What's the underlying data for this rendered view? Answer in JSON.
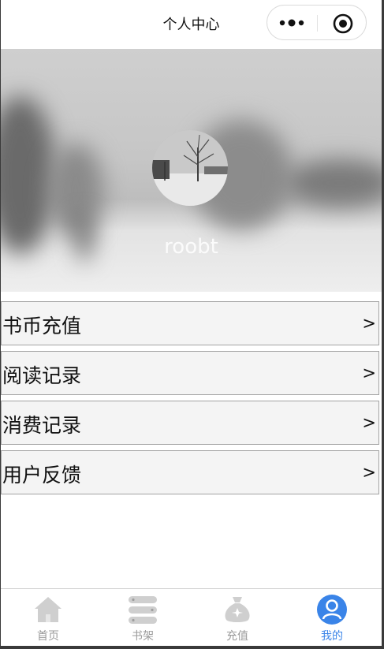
{
  "navbar": {
    "title": "个人中心"
  },
  "profile": {
    "username": "roobt"
  },
  "menu": {
    "items": [
      {
        "label": "书币充值",
        "arrow": ">"
      },
      {
        "label": "阅读记录",
        "arrow": ">"
      },
      {
        "label": "消费记录",
        "arrow": ">"
      },
      {
        "label": "用户反馈",
        "arrow": ">"
      }
    ]
  },
  "tabbar": {
    "items": [
      {
        "label": "首页",
        "icon": "home-icon",
        "active": false
      },
      {
        "label": "书架",
        "icon": "bookshelf-icon",
        "active": false
      },
      {
        "label": "充值",
        "icon": "money-bag-icon",
        "active": false
      },
      {
        "label": "我的",
        "icon": "user-icon",
        "active": true
      }
    ]
  },
  "colors": {
    "accent": "#3a84e8",
    "inactive": "#9a9a9a",
    "menu_bg": "#f4f4f4"
  }
}
